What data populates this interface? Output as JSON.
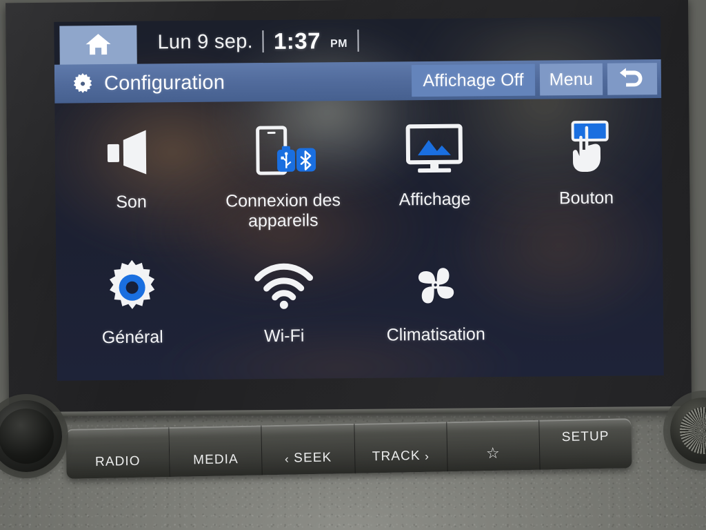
{
  "status_bar": {
    "home_icon": "home-icon",
    "date": "Lun 9 sep.",
    "time": "1:37",
    "ampm": "PM"
  },
  "title_bar": {
    "icon": "gear-icon",
    "title": "Configuration",
    "actions": [
      {
        "label": "Affichage Off",
        "name": "display-off-button"
      },
      {
        "label": "Menu",
        "name": "menu-button"
      },
      {
        "label": "",
        "name": "back-button",
        "icon": "back-arrow-icon"
      }
    ]
  },
  "menu": {
    "tiles": [
      {
        "label": "Son",
        "icon": "speaker-icon"
      },
      {
        "label": "Connexion des appareils",
        "icon": "device-connection-icon"
      },
      {
        "label": "Affichage",
        "icon": "display-monitor-icon"
      },
      {
        "label": "Bouton",
        "icon": "touch-button-icon"
      },
      {
        "label": "Général",
        "icon": "gear-icon"
      },
      {
        "label": "Wi-Fi",
        "icon": "wifi-icon"
      },
      {
        "label": "Climatisation",
        "icon": "fan-icon"
      }
    ]
  },
  "hardware_buttons": [
    {
      "label": "RADIO",
      "name": "radio-button"
    },
    {
      "label": "MEDIA",
      "name": "media-button"
    },
    {
      "label": "SEEK",
      "name": "seek-button",
      "prefix": "‹"
    },
    {
      "label": "TRACK",
      "name": "track-button",
      "suffix": "›"
    },
    {
      "label": "☆",
      "name": "favorite-button"
    },
    {
      "label": "SETUP",
      "name": "setup-button"
    }
  ],
  "colors": {
    "accent_blue": "#1a6fe0",
    "titlebar_blue": "#516b9c",
    "button_blue": "#6f8cbe",
    "home_blue": "#8fa6cb",
    "screen_bg": "#1c2031",
    "text_white": "#f4f5f7"
  }
}
